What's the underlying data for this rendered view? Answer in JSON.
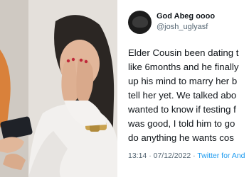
{
  "tweet": {
    "display_name": "God Abeg oooo",
    "handle": "@josh_uglyasf",
    "lines": [
      "Elder Cousin been dating t",
      "like 6months and he finally",
      "up his mind to marry her b",
      "tell her yet. We talked abo",
      "wanted to know if testing f",
      "was good, I told him to go",
      "do anything he wants cos"
    ],
    "timestamp": "13:14 · 07/12/2022 · ",
    "source": "Twitter for And"
  }
}
